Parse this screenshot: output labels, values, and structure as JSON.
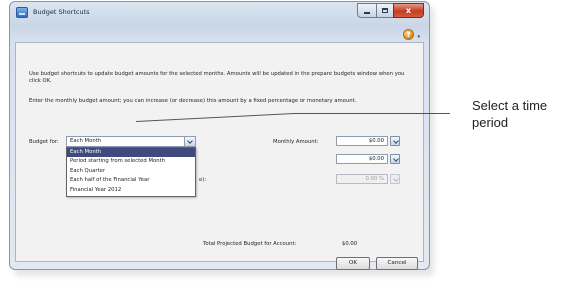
{
  "window": {
    "title": "Budget Shortcuts",
    "close_glyph": "x",
    "help_glyph": "?",
    "help_arrow_glyph": "▾"
  },
  "intro": {
    "line1": "Use budget shortcuts to update budget amounts for the selected months. Amounts will be updated in the prepare budgets window when you click OK.",
    "line2": "Enter the monthly budget amount; you can increase (or decrease) this amount by a fixed percentage or monetary amount."
  },
  "budget_for": {
    "label": "Budget for:",
    "selected": "Each Month",
    "options": [
      "Each Month",
      "Period starting from selected Month",
      "Each Quarter",
      "Each half of the Financial Year",
      "Financial Year 2012"
    ]
  },
  "monthly_amount": {
    "label": "Monthly Amount:",
    "value": "$0.00"
  },
  "second_amount": {
    "value": "$0.00"
  },
  "partial_label": "e):",
  "percentage": {
    "value": "0.00 %"
  },
  "total": {
    "label": "Total Projected Budget for Account:",
    "value": "$0.00"
  },
  "buttons": {
    "ok": "OK",
    "cancel": "Cancel"
  },
  "callout": {
    "text": "Select a time period"
  },
  "icons": {
    "app": "budget-app-icon",
    "help": "help-icon",
    "minimize": "minimize-icon",
    "maximize": "maximize-icon",
    "close": "close-icon",
    "dropdown": "chevron-down-icon",
    "calculator": "calculator-icon"
  },
  "colors": {
    "selected_option_bg": "#3f4a7e",
    "close_button": "#c73a20",
    "title_bar": "#c9d6e6"
  }
}
